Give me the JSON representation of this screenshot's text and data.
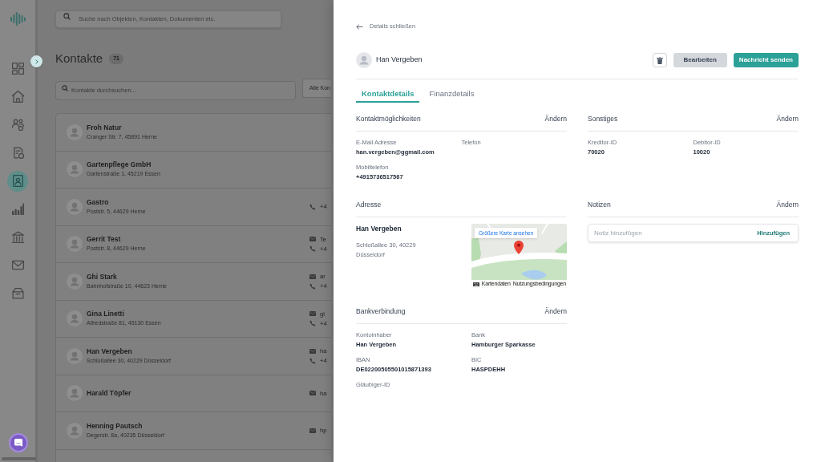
{
  "global_search": {
    "placeholder": "Suche nach Objekten, Kontakten, Dokumenten etc."
  },
  "sidebar": {
    "items": [
      {
        "selected": false
      },
      {
        "selected": false
      },
      {
        "selected": false
      },
      {
        "selected": false
      },
      {
        "selected": true
      },
      {
        "selected": false
      },
      {
        "selected": false
      },
      {
        "selected": false
      },
      {
        "selected": false
      }
    ]
  },
  "contacts": {
    "title": "Kontakte",
    "count": "71",
    "search": {
      "placeholder": "Kontakte durchsuchen..."
    },
    "filter": {
      "label": "Alle Kon"
    },
    "rows": [
      {
        "name": "Froh Natur",
        "address": "Cranger Str. 7, 45891 Herne"
      },
      {
        "name": "Gartenpflege GmbH",
        "address": "Gartenstraße 1, 45219 Essen"
      },
      {
        "name": "Gastro",
        "address": "Poststr. 5, 44629 Herne",
        "phone": "+4"
      },
      {
        "name": "Gerrit Test",
        "address": "Poststr. 8, 44629 Herne",
        "email": "Te",
        "phone": "+4"
      },
      {
        "name": "Ghi Stark",
        "address": "Bahnhofstraße 10, 44623 Herne",
        "email": "ar",
        "phone": "+4"
      },
      {
        "name": "Gina Linetti",
        "address": "Alfredstraße 81, 45130 Essen",
        "email": "gi",
        "phone": "+4"
      },
      {
        "name": "Han Vergeben",
        "address": "Schloßallee 30, 40229 Düsseldorf",
        "email": "ha",
        "phone": "+4"
      },
      {
        "name": "Harald Töpfer",
        "email": "ha"
      },
      {
        "name": "Henning Pautsch",
        "address": "Degerstr. 8a, 40235 Düsseldorf",
        "email": "hp"
      }
    ]
  },
  "details": {
    "back": "Details schließen",
    "name": "Han Vergeben",
    "buttons": [
      {
        "label": "Bearbeiten",
        "kind": "secondary"
      },
      {
        "label": "Nachricht senden",
        "kind": "primary"
      }
    ],
    "tabs": [
      {
        "label": "Kontaktdetails",
        "selected": true
      },
      {
        "label": "Finanzdetails",
        "selected": false
      }
    ],
    "contact_options": {
      "title": "Kontaktmöglichkeiten",
      "action": "Ändern",
      "fields": [
        {
          "label": "E-Mail Adresse",
          "value": "han.vergeben@ggmail.com"
        },
        {
          "label": "Telefon"
        },
        {
          "label": "Mobiltelefon",
          "value": "+4915736517567"
        }
      ]
    },
    "other": {
      "title": "Sonstiges",
      "action": "Ändern",
      "fields": [
        {
          "label": "Kreditor-ID",
          "value": "70020"
        },
        {
          "label": "Debitor-ID",
          "value": "10020"
        }
      ]
    },
    "address": {
      "title": "Adresse",
      "name": "Han Vergeben",
      "text": "Schloßallee 30, 40229 Düsseldorf",
      "map": {
        "button": "Größere Karte ansehen",
        "attribution": [
          "Kartendaten",
          "Nutzungsbedingungen"
        ]
      }
    },
    "notes": {
      "title": "Notizen",
      "action": "Ändern",
      "placeholder": "Notiz hinzufügen",
      "button": "Hinzufügen"
    },
    "bank": {
      "title": "Bankverbindung",
      "action": "Ändern",
      "fields": [
        {
          "label": "Kontoinhaber",
          "value": "Han Vergeben"
        },
        {
          "label": "Bank",
          "value": "Hamburger Sparkasse"
        },
        {
          "label": "IBAN",
          "value": "DE02200505501015871393"
        },
        {
          "label": "BIC",
          "value": "HASPDEHH"
        },
        {
          "label": "Gläubiger-ID"
        }
      ]
    }
  }
}
